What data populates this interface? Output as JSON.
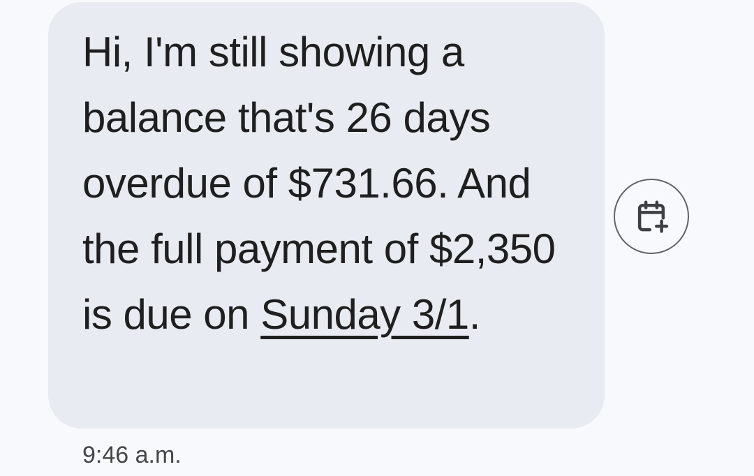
{
  "message": {
    "text_before_link": "Hi, I'm still showing a balance that's 26 days overdue of $731.66. And the full payment of $2,350 is due on ",
    "date_link": "Sunday 3/1",
    "text_after_link": ".",
    "timestamp": "9:46 a.m."
  },
  "actions": {
    "add_to_calendar_icon": "calendar-add-icon"
  },
  "colors": {
    "background": "#f8f9fd",
    "bubble": "#e9ebf2",
    "text": "#1f1f1f",
    "timestamp": "#444746",
    "icon": "#3c4043"
  }
}
